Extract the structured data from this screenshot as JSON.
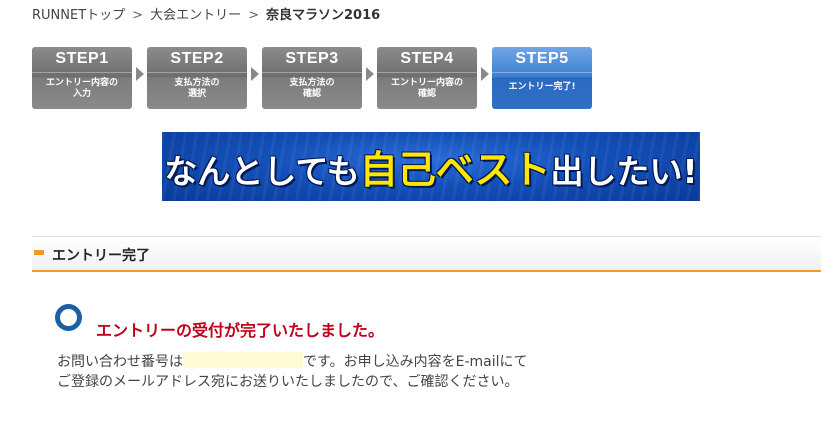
{
  "breadcrumb": {
    "items": [
      "RUNNETトップ",
      "大会エントリー",
      "奈良マラソン2016"
    ],
    "separator": ">"
  },
  "steps": [
    {
      "num": "STEP1",
      "label_line1": "エントリー内容の",
      "label_line2": "入力",
      "active": false
    },
    {
      "num": "STEP2",
      "label_line1": "支払方法の",
      "label_line2": "選択",
      "active": false
    },
    {
      "num": "STEP3",
      "label_line1": "支払方法の",
      "label_line2": "確認",
      "active": false
    },
    {
      "num": "STEP4",
      "label_line1": "エントリー内容の",
      "label_line2": "確認",
      "active": false
    },
    {
      "num": "STEP5",
      "label_line1": "エントリー完了!",
      "label_line2": "",
      "active": true
    }
  ],
  "banner": {
    "prefix": "なんとしても",
    "highlight": "自己ベスト",
    "suffix": "出したい!"
  },
  "section": {
    "title": "エントリー完了"
  },
  "completion": {
    "message": "エントリーの受付が完了いたしました。",
    "line1_before": "お問い合わせ番号は",
    "line1_after": "です。お申し込み内容をE-mailにて",
    "line2": "ご登録のメールアドレス宛にお送りいたしましたので、ご確認ください。"
  },
  "colors": {
    "accent_orange": "#f09a2c",
    "message_red": "#c0001a",
    "step_active_blue": "#3d7fd0",
    "step_inactive_gray": "#7c7c7c",
    "circle_blue": "#1d5fa3",
    "banner_highlight": "#ffe600"
  }
}
